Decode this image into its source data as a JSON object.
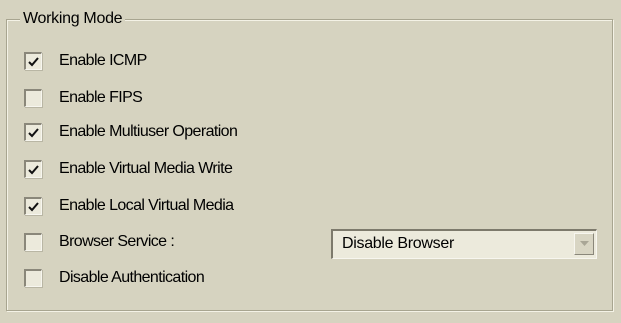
{
  "group": {
    "title": "Working Mode"
  },
  "options": [
    {
      "label": "Enable ICMP",
      "checked": true
    },
    {
      "label": "Enable FIPS",
      "checked": false
    },
    {
      "label": "Enable Multiuser Operation",
      "checked": true
    },
    {
      "label": "Enable Virtual Media Write",
      "checked": true
    },
    {
      "label": "Enable Local Virtual Media",
      "checked": true
    },
    {
      "label": "Browser Service :",
      "checked": false
    },
    {
      "label": "Disable Authentication",
      "checked": false
    }
  ],
  "browser_service": {
    "selected": "Disable Browser"
  },
  "icons": {
    "check": "checkmark-icon",
    "dropdown": "chevron-down-icon"
  }
}
